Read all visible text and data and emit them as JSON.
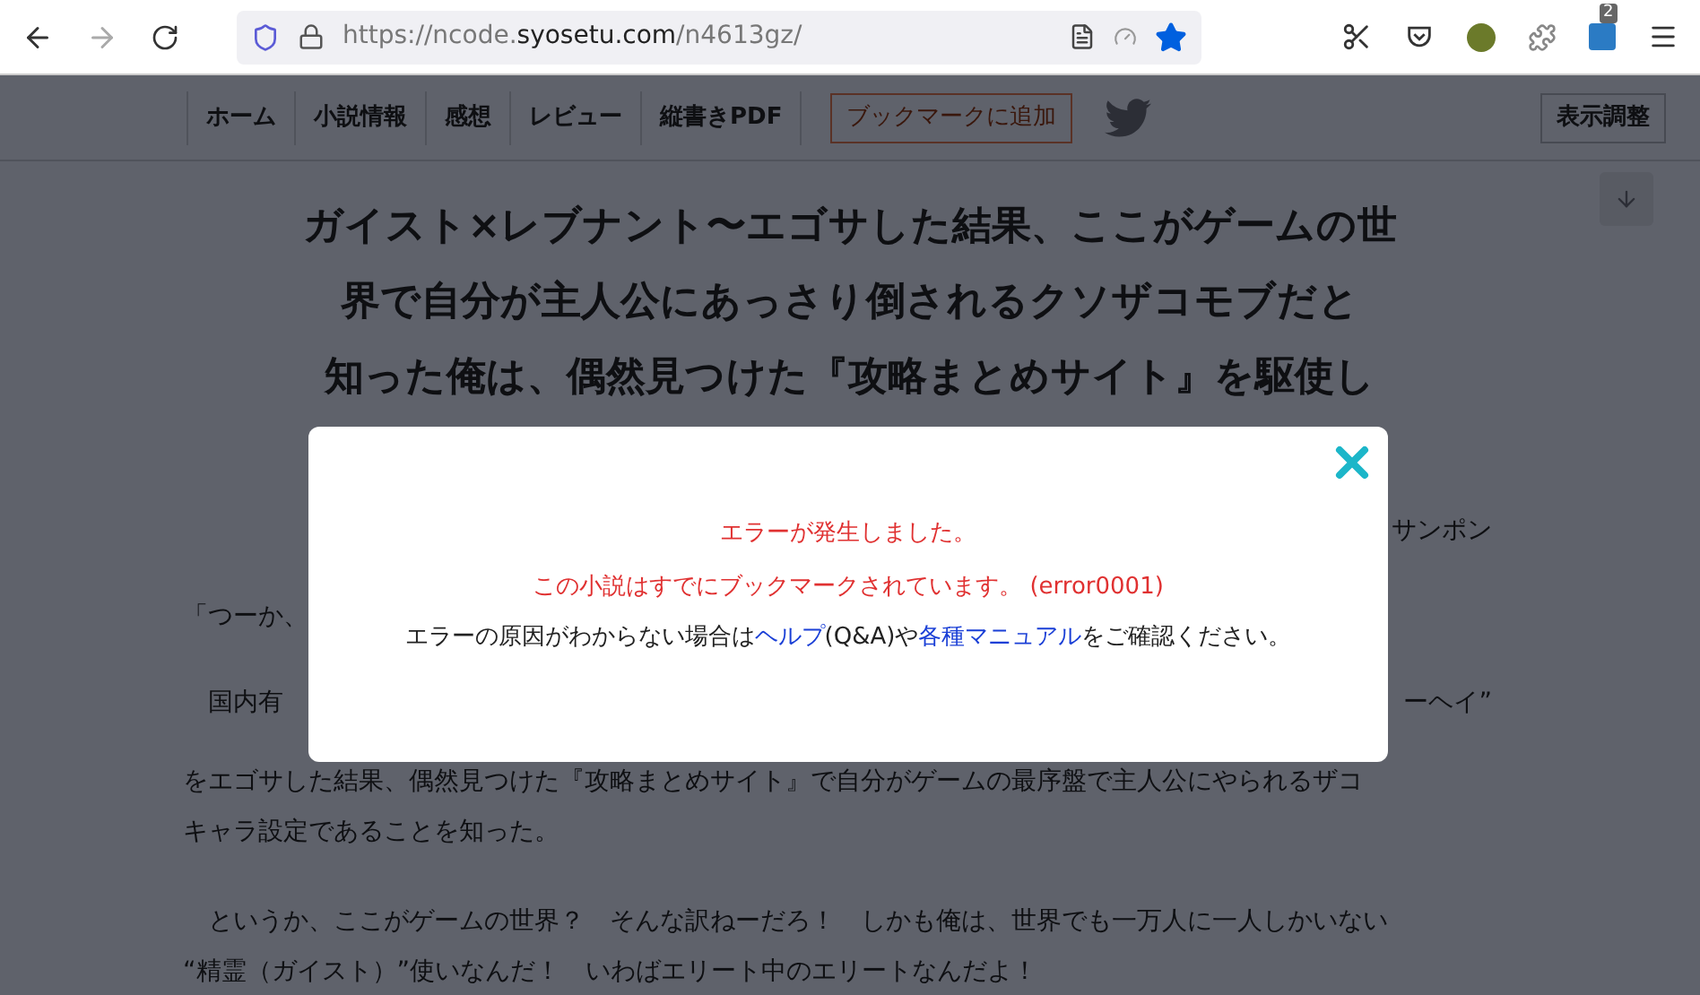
{
  "browser": {
    "url": {
      "prefix": "https://ncode.",
      "domain": "syosetu.com",
      "path": "/n4613gz/"
    },
    "bookmarked": true,
    "extension_badge": "2"
  },
  "nav": {
    "items": [
      "ホーム",
      "小説情報",
      "感想",
      "レビュー",
      "縦書きPDF"
    ],
    "bookmark_button": "ブックマークに追加",
    "display_button": "表示調整"
  },
  "novel": {
    "title_lines": [
      "ガイスト×レブナント〜エゴサした結果、ここがゲームの世",
      "界で自分が主人公にあっさり倒されるクソザコモブだと",
      "知った俺は、偶然見つけた『攻略まとめサイト』を駆使し"
    ],
    "body": [
      {
        "kind": "right",
        "text": "サンポン"
      },
      {
        "kind": "left",
        "text": "「つーか、"
      },
      {
        "kind": "split",
        "left": "　国内有",
        "right": "ーヘイ”"
      },
      {
        "kind": "left",
        "text": "をエゴサした結果、偶然見つけた『攻略まとめサイト』で自分がゲームの最序盤で主人公にやられるザコ"
      },
      {
        "kind": "left",
        "text": "キャラ設定であることを知った。"
      },
      {
        "kind": "blank"
      },
      {
        "kind": "left",
        "text": "　というか、ここがゲームの世界？　そんな訳ねーだろ！　しかも俺は、世界でも一万人に一人しかいない"
      },
      {
        "kind": "left",
        "text": "“精霊（ガイスト）”使いなんだ！　いわばエリート中のエリートなんだよ！"
      }
    ]
  },
  "dialog": {
    "error_title": "エラーが発生しました。",
    "error_detail": "この小説はすでにブックマークされています。 (error0001)",
    "help_before": "エラーの原因がわからない場合は",
    "help_link": "ヘルプ",
    "help_middle": "(Q&A)や",
    "manual_link": "各種マニュアル",
    "help_after": "をご確認ください。"
  }
}
